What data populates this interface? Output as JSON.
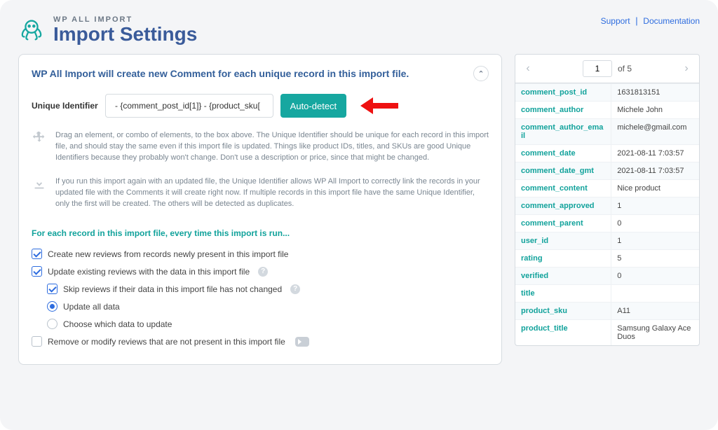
{
  "header": {
    "brand_small": "WP ALL IMPORT",
    "brand_big": "Import Settings",
    "links": {
      "support": "Support",
      "documentation": "Documentation"
    }
  },
  "panel": {
    "title": "WP All Import will create new Comment for each unique record in this import file.",
    "uid_label": "Unique Identifier",
    "uid_value": " - {comment_post_id[1]} - {product_sku[",
    "auto_detect": "Auto-detect",
    "info1": "Drag an element, or combo of elements, to the box above. The Unique Identifier should be unique for each record in this import file, and should stay the same even if this import file is updated. Things like product IDs, titles, and SKUs are good Unique Identifiers because they probably won't change. Don't use a description or price, since that might be changed.",
    "info2": "If you run this import again with an updated file, the Unique Identifier allows WP All Import to correctly link the records in your updated file with the Comments it will create right now. If multiple records in this import file have the same Unique Identifier, only the first will be created. The others will be detected as duplicates.",
    "section_heading": "For each record in this import file, every time this import is run...",
    "opts": {
      "create_new": "Create new reviews from records newly present in this import file",
      "update_existing": "Update existing reviews with the data in this import file",
      "skip_unchanged": "Skip reviews if their data in this import file has not changed",
      "update_all": "Update all data",
      "choose_which": "Choose which data to update",
      "remove_missing": "Remove or modify reviews that are not present in this import file"
    }
  },
  "pager": {
    "page": "1",
    "of_label": "of 5"
  },
  "record": [
    {
      "k": "comment_post_id",
      "v": "1631813151"
    },
    {
      "k": "comment_author",
      "v": "Michele John"
    },
    {
      "k": "comment_author_email",
      "v": "michele@gmail.com"
    },
    {
      "k": "comment_date",
      "v": "2021-08-11 7:03:57"
    },
    {
      "k": "comment_date_gmt",
      "v": "2021-08-11 7:03:57"
    },
    {
      "k": "comment_content",
      "v": "Nice product"
    },
    {
      "k": "comment_approved",
      "v": "1"
    },
    {
      "k": "comment_parent",
      "v": "0"
    },
    {
      "k": "user_id",
      "v": "1"
    },
    {
      "k": "rating",
      "v": "5"
    },
    {
      "k": "verified",
      "v": "0"
    },
    {
      "k": "title",
      "v": ""
    },
    {
      "k": "product_sku",
      "v": "A11"
    },
    {
      "k": "product_title",
      "v": "Samsung Galaxy Ace Duos"
    }
  ]
}
